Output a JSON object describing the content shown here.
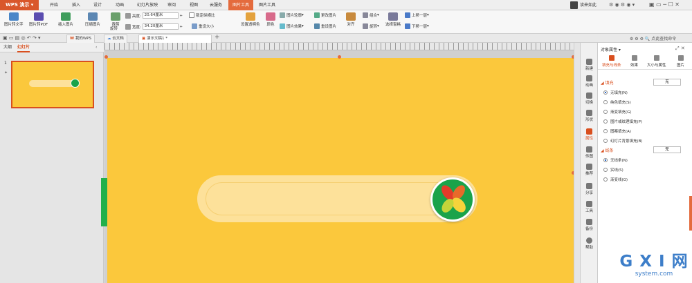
{
  "menubar": {
    "app_name": "WPS 演示",
    "tabs": [
      "开始",
      "插入",
      "设计",
      "动画",
      "幻灯片放映",
      "审阅",
      "视图",
      "云服务",
      "图片工具",
      "图片工具"
    ],
    "user": "读来如此",
    "active_tab": "图片工具"
  },
  "ribbon": {
    "pic_to_text": "图片转文字",
    "pic_to_pdf": "图片转PDF",
    "insert_pic": "插入图片",
    "compress": "压缩图片",
    "crop": "裁剪",
    "rotate": "旋转",
    "height_label": "高度:",
    "height_value": "20.64厘米",
    "width_label": "宽度:",
    "width_value": "34.20厘米",
    "lock_ratio": "锁定纵横比",
    "reset_size": "重设大小",
    "set_transparent": "设置透明色",
    "color": "颜色",
    "pic_outline": "图片轮廓",
    "pic_effect": "图片效果",
    "change_pic": "更改图片",
    "reset_pic": "重设图片",
    "align": "对齐",
    "combine": "组合",
    "rotate2": "旋转",
    "select_pane": "选择窗格",
    "bring_forward": "上移一层",
    "send_backward": "下移一层"
  },
  "tabbar": {
    "my_wps": "我的WPS",
    "cloud_doc": "云文档",
    "doc_name": "演示文稿1 *",
    "search": "点此查找命令"
  },
  "left_pane": {
    "outline_tab": "大纲",
    "slides_tab": "幻灯片",
    "slide_number": "1"
  },
  "sidebar": [
    "新建",
    "动画",
    "切换",
    "形状",
    "属性",
    "传图",
    "推荐",
    "分享",
    "工具",
    "备份",
    "帮助"
  ],
  "props": {
    "title": "对象属性",
    "tabs": [
      "填充与线条",
      "效果",
      "大小与属性",
      "图片"
    ],
    "fill_header": "填充",
    "fill_value": "无",
    "fill_options": [
      "无填充(N)",
      "纯色填充(S)",
      "渐变填充(G)",
      "图片或纹理填充(P)",
      "图案填充(A)",
      "幻灯片背景填充(B)"
    ],
    "line_header": "线条",
    "line_value": "无",
    "line_options": [
      "无线条(N)",
      "实线(S)",
      "渐变线(G)"
    ]
  },
  "watermark": {
    "logo": "G X I 网",
    "domain": "system.com"
  },
  "colors": {
    "accent": "#e46b3d",
    "slide_bg": "#fbc83c",
    "pill": "#fde19a",
    "icon_green": "#1aa34a"
  }
}
